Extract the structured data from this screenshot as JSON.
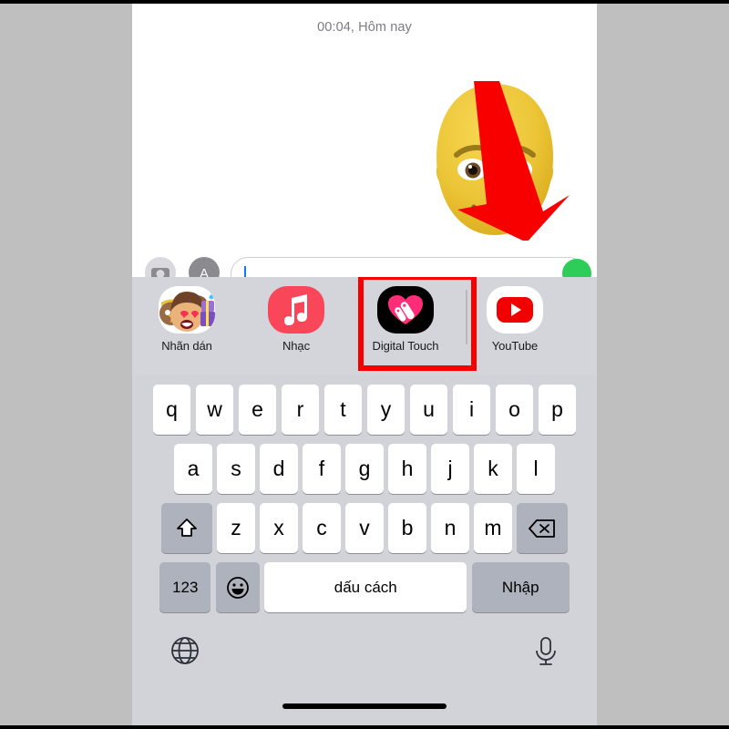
{
  "conversation": {
    "timestamp": "00:04, Hôm nay",
    "memoji_alt": "memoji-face-bald-yellow",
    "annotation": {
      "type": "red-down-arrow",
      "color": "#f80000"
    }
  },
  "input_bar": {
    "camera_icon": "camera-icon",
    "appstore_icon": "app-store-icon",
    "text_value": "",
    "placeholder": "",
    "send_icon": "send-arrow-icon",
    "send_color": "#2ecc58"
  },
  "app_drawer": {
    "highlight_color": "#f80000",
    "background": "#d3d5da",
    "items": [
      {
        "label": "Nhãn dán",
        "icon": "sticker-memoji-icon",
        "highlighted": false
      },
      {
        "label": "Nhạc",
        "icon": "music-note-icon",
        "highlighted": false
      },
      {
        "label": "Digital Touch",
        "icon": "digital-touch-heart-icon",
        "highlighted": true
      },
      {
        "label": "YouTube",
        "icon": "youtube-play-icon",
        "highlighted": false
      }
    ]
  },
  "keyboard": {
    "background": "#d1d3d9",
    "row1": [
      "q",
      "w",
      "e",
      "r",
      "t",
      "y",
      "u",
      "i",
      "o",
      "p"
    ],
    "row2": [
      "a",
      "s",
      "d",
      "f",
      "g",
      "h",
      "j",
      "k",
      "l"
    ],
    "row3": [
      "z",
      "x",
      "c",
      "v",
      "b",
      "n",
      "m"
    ],
    "shift_icon": "shift-arrow-icon",
    "backspace_icon": "backspace-icon",
    "numeric_label": "123",
    "emoji_icon": "emoji-smiley-icon",
    "space_label": "dấu cách",
    "return_label": "Nhập",
    "globe_icon": "globe-icon",
    "mic_icon": "microphone-icon"
  }
}
